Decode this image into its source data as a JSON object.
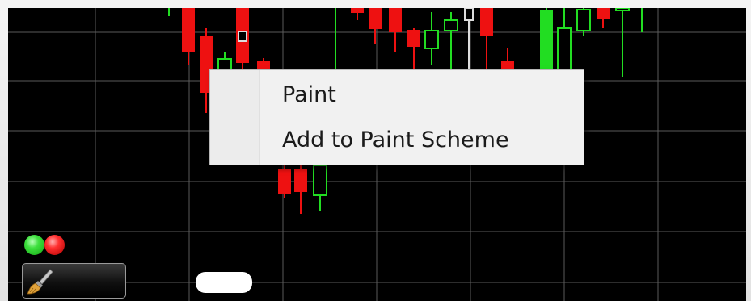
{
  "context_menu": {
    "items": [
      {
        "label": "Paint"
      },
      {
        "label": "Add to Paint Scheme"
      }
    ]
  },
  "chart": {
    "background": "#000000",
    "grid_color": "#5a5a5a",
    "up_color": "#22dd22",
    "down_color": "#ee1111",
    "highlight_color": "#dddddd"
  },
  "toolbar": {
    "color_dots": [
      "#22cc22",
      "#ee2222"
    ],
    "paint_button_icon": "paintbrush-icon"
  }
}
